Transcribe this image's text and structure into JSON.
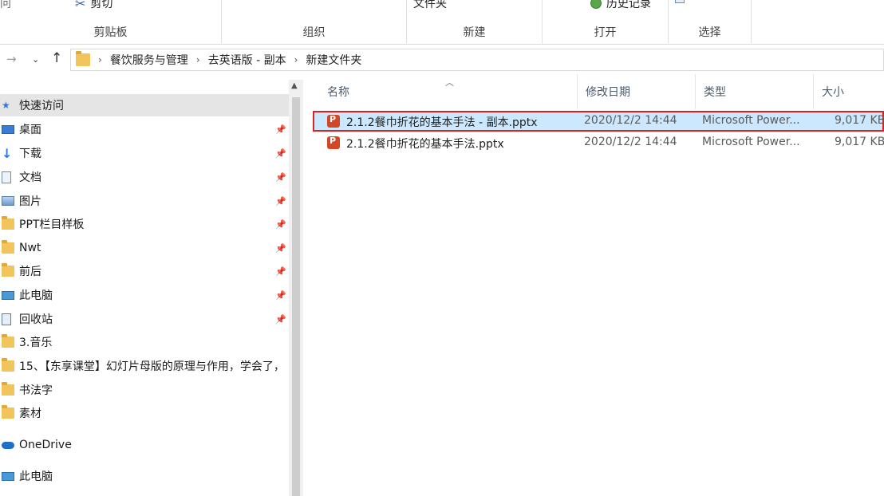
{
  "ribbon": {
    "groups": [
      {
        "caption": "剪贴板",
        "items": [
          {
            "label": "剪切",
            "icon": "scissors-icon"
          }
        ]
      },
      {
        "caption": "组织",
        "items": []
      },
      {
        "caption": "新建",
        "items": [
          {
            "label": "文件夹",
            "icon": ""
          }
        ]
      },
      {
        "caption": "打开",
        "items": [
          {
            "label": "历史记录",
            "icon": "history-icon"
          }
        ]
      },
      {
        "caption": "选择",
        "items": []
      }
    ],
    "partial_left_text": "问"
  },
  "navigation": {
    "back_icon": "back-arrow-icon",
    "forward_icon": "forward-arrow-icon",
    "recent_icon": "chevron-down-icon",
    "up_icon": "up-arrow-icon"
  },
  "address": {
    "crumbs": [
      "餐饮服务与管理",
      "去英语版 - 副本",
      "新建文件夹"
    ]
  },
  "nav_pane": {
    "items": [
      {
        "label": "快速访问",
        "icon": "star-icon",
        "pinned": false,
        "selected": true
      },
      {
        "label": "桌面",
        "icon": "desktop-icon",
        "pinned": true
      },
      {
        "label": "下载",
        "icon": "download-icon",
        "pinned": true
      },
      {
        "label": "文档",
        "icon": "document-icon",
        "pinned": true
      },
      {
        "label": "图片",
        "icon": "picture-icon",
        "pinned": true
      },
      {
        "label": "PPT栏目样板",
        "icon": "folder-icon",
        "pinned": true
      },
      {
        "label": "Nwt",
        "icon": "folder-icon",
        "pinned": true
      },
      {
        "label": "前后",
        "icon": "folder-icon",
        "pinned": true
      },
      {
        "label": "此电脑",
        "icon": "computer-icon",
        "pinned": true
      },
      {
        "label": "回收站",
        "icon": "recycle-bin-icon",
        "pinned": true
      },
      {
        "label": "3.音乐",
        "icon": "folder-icon",
        "pinned": false
      },
      {
        "label": "15、【东享课堂】幻灯片母版的原理与作用，学会了，",
        "icon": "folder-icon",
        "pinned": false
      },
      {
        "label": "书法字",
        "icon": "folder-icon",
        "pinned": false
      },
      {
        "label": "素材",
        "icon": "folder-icon",
        "pinned": false
      },
      {
        "label": "OneDrive",
        "icon": "cloud-icon",
        "pinned": false
      },
      {
        "label": "此电脑",
        "icon": "computer-icon",
        "pinned": false
      }
    ]
  },
  "file_list": {
    "headers": {
      "name": "名称",
      "modified": "修改日期",
      "type": "类型",
      "size": "大小"
    },
    "rows": [
      {
        "name": "2.1.2餐巾折花的基本手法 - 副本.pptx",
        "modified": "2020/12/2 14:44",
        "type": "Microsoft Power...",
        "size": "9,017 KB",
        "selected": true
      },
      {
        "name": "2.1.2餐巾折花的基本手法.pptx",
        "modified": "2020/12/2 14:44",
        "type": "Microsoft Power...",
        "size": "9,017 KB",
        "selected": false
      }
    ]
  },
  "colors": {
    "selection": "#cce8ff",
    "highlight_border": "#e02020",
    "ppt_icon": "#d24726"
  }
}
